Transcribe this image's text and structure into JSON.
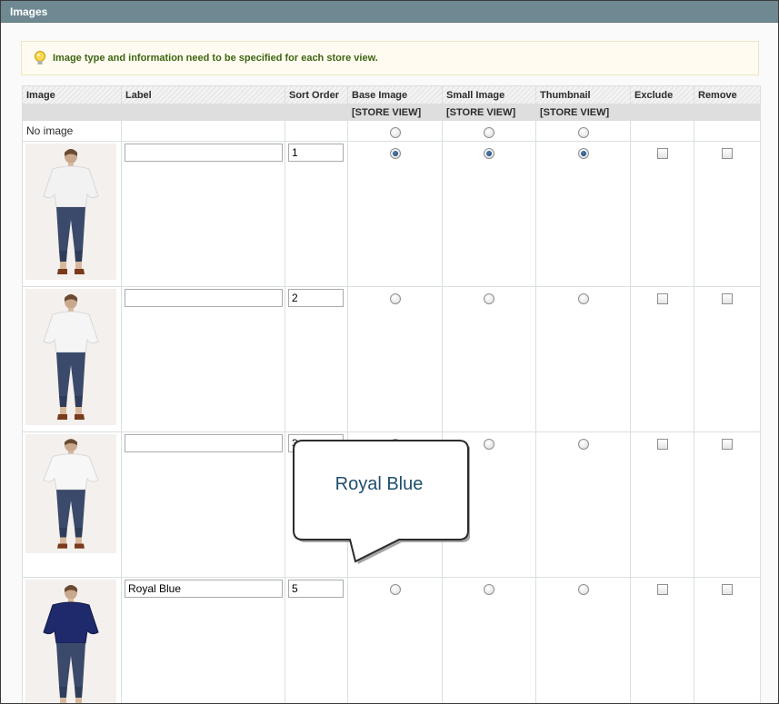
{
  "section": {
    "title": "Images"
  },
  "notice": {
    "text": "Image type and information need to be specified for each store view.",
    "icon": "lightbulb-icon"
  },
  "table": {
    "headers": {
      "image": "Image",
      "label": "Label",
      "sort_order": "Sort Order",
      "base_image": "Base Image",
      "small_image": "Small Image",
      "thumbnail": "Thumbnail",
      "exclude": "Exclude",
      "remove": "Remove"
    },
    "scope": {
      "base_image": "[STORE VIEW]",
      "small_image": "[STORE VIEW]",
      "thumbnail": "[STORE VIEW]"
    },
    "no_image_label": "No image",
    "rows": [
      {
        "label": "",
        "sort_order": "1",
        "shirt_color": "#f2f2f2",
        "base": true,
        "small": true,
        "thumb": true,
        "exclude": false,
        "remove": false
      },
      {
        "label": "",
        "sort_order": "2",
        "shirt_color": "#f5f5f5",
        "base": false,
        "small": false,
        "thumb": false,
        "exclude": false,
        "remove": false
      },
      {
        "label": "",
        "sort_order": "3",
        "shirt_color": "#f7f7f7",
        "base": false,
        "small": false,
        "thumb": false,
        "exclude": false,
        "remove": false
      },
      {
        "label": "Royal Blue",
        "sort_order": "5",
        "shirt_color": "#1e2a6b",
        "base": false,
        "small": false,
        "thumb": false,
        "exclude": false,
        "remove": false
      }
    ]
  },
  "callout": {
    "text": "Royal Blue"
  },
  "colors": {
    "header_bar": "#6f8992",
    "notice_text": "#3d6611",
    "callout_text": "#1f4e6e"
  }
}
